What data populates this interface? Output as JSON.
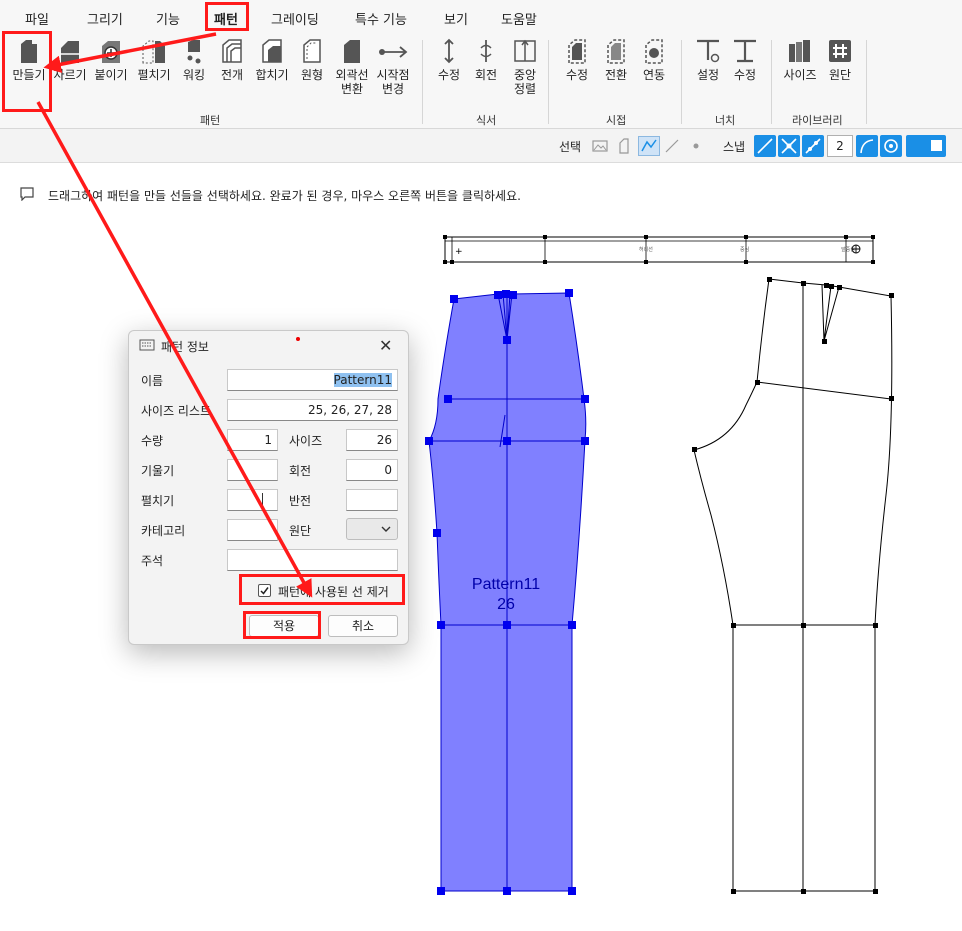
{
  "menu": {
    "items": [
      "파일",
      "그리기",
      "기능",
      "패턴",
      "그레이딩",
      "특수 기능",
      "보기",
      "도움말"
    ],
    "active": "패턴"
  },
  "ribbon": {
    "tools": [
      {
        "label": "만들기",
        "icon": "create-pattern-icon"
      },
      {
        "label": "자르기",
        "icon": "cut-pattern-icon"
      },
      {
        "label": "붙이기",
        "icon": "attach-pattern-icon"
      },
      {
        "label": "펼치기",
        "icon": "unfold-pattern-icon"
      },
      {
        "label": "워킹",
        "icon": "walking-icon"
      },
      {
        "label": "전개",
        "icon": "develop-icon"
      },
      {
        "label": "합치기",
        "icon": "merge-icon"
      },
      {
        "label": "원형",
        "icon": "original-icon"
      },
      {
        "label": "외곽선\n변환",
        "icon": "outline-convert-icon"
      },
      {
        "label": "시작점\n변경",
        "icon": "start-point-icon"
      },
      {
        "label": "수정",
        "icon": "grain-edit-icon"
      },
      {
        "label": "회전",
        "icon": "grain-rotate-icon"
      },
      {
        "label": "중앙\n정렬",
        "icon": "center-align-icon"
      },
      {
        "label": "수정",
        "icon": "seam-edit-icon"
      },
      {
        "label": "전환",
        "icon": "seam-switch-icon"
      },
      {
        "label": "연동",
        "icon": "seam-link-icon"
      },
      {
        "label": "설정",
        "icon": "notch-settings-icon"
      },
      {
        "label": "수정",
        "icon": "notch-edit-icon"
      },
      {
        "label": "사이즈",
        "icon": "size-library-icon"
      },
      {
        "label": "원단",
        "icon": "fabric-icon"
      }
    ],
    "groups": [
      "패턴",
      "식서",
      "시접",
      "너치",
      "라이브러리"
    ]
  },
  "options": {
    "select_label": "선택",
    "snap_label": "스냅",
    "snap_value": "2"
  },
  "hint": "드래그하여 패턴을 만들 선들을 선택하세요. 완료가 된 경우, 마우스 오른쪽 버튼을 클릭하세요.",
  "pattern": {
    "name": "Pattern11",
    "size": "26",
    "strip_labels": [
      "허리선",
      "중심",
      "앞중심"
    ]
  },
  "dialog": {
    "title": "패턴 정보",
    "fields": {
      "name_label": "이름",
      "name_value": "Pattern11",
      "sizelist_label": "사이즈 리스트",
      "sizelist_value": "25, 26, 27, 28",
      "qty_label": "수량",
      "qty_value": "1",
      "size_label": "사이즈",
      "size_value": "26",
      "tilt_label": "기울기",
      "tilt_value": "",
      "rotate_label": "회전",
      "rotate_value": "0",
      "unfold_label": "펼치기",
      "unfold_value": "",
      "flip_label": "반전",
      "flip_value": "",
      "category_label": "카테고리",
      "category_value": "",
      "fabric_label": "원단",
      "note_label": "주석",
      "note_value": ""
    },
    "remove_lines_label": "패턴에 사용된 선 제거",
    "remove_lines_checked": true,
    "apply_label": "적용",
    "cancel_label": "취소"
  },
  "colors": {
    "accent": "#1a8fe6",
    "pattern_fill": "#8080ff",
    "pattern_stroke": "#0000cc",
    "annotation": "#ff1a1a"
  }
}
